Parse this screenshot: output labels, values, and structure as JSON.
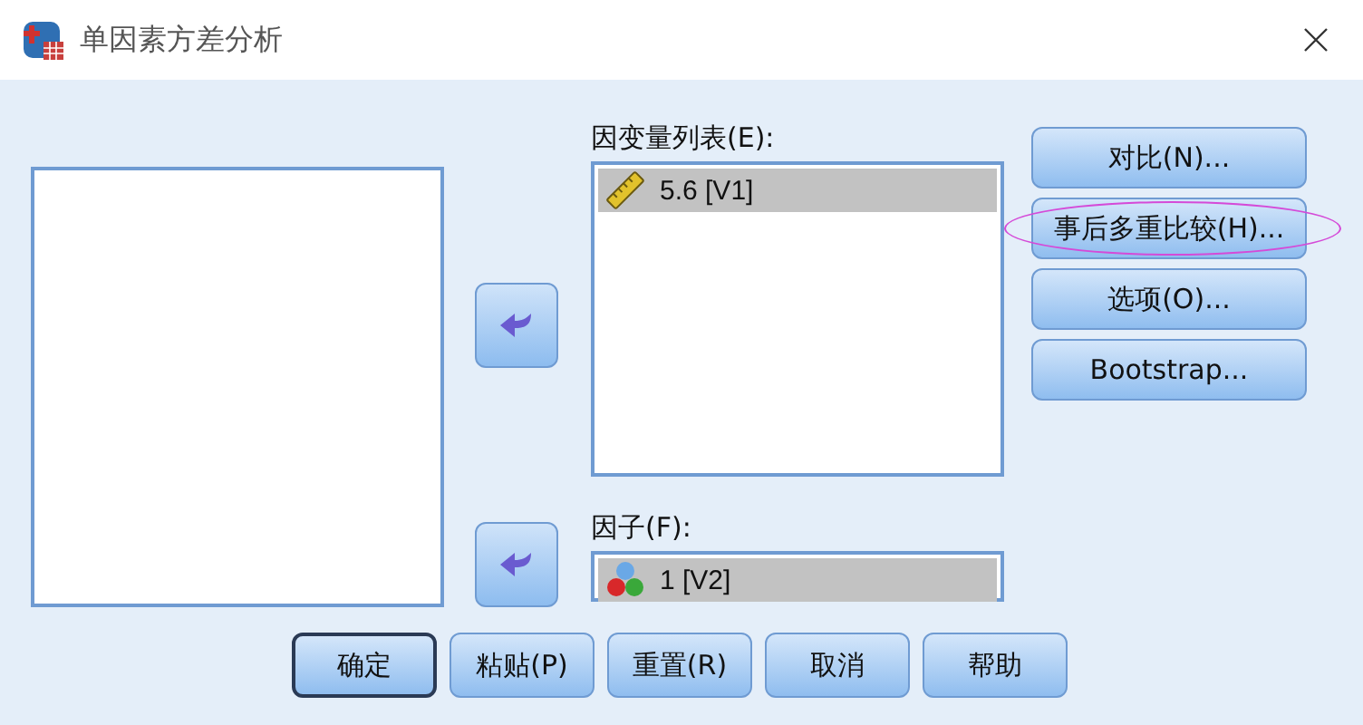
{
  "window": {
    "title": "单因素方差分析"
  },
  "dependent_list": {
    "label": "因变量列表(E):",
    "items": [
      {
        "name": "5.6 [V1]",
        "kind": "scale",
        "selected": true
      }
    ]
  },
  "factor": {
    "label": "因子(F):",
    "item": {
      "name": "1 [V2]",
      "kind": "nominal",
      "selected": true
    }
  },
  "side_buttons": [
    {
      "label": "对比(N)...",
      "circled": false
    },
    {
      "label": "事后多重比较(H)...",
      "circled": true
    },
    {
      "label": "选项(O)...",
      "circled": false
    },
    {
      "label": "Bootstrap...",
      "circled": false
    }
  ],
  "bottom_buttons": [
    {
      "label": "确定",
      "default": true
    },
    {
      "label": "粘贴(P)",
      "default": false
    },
    {
      "label": "重置(R)",
      "default": false
    },
    {
      "label": "取消",
      "default": false
    },
    {
      "label": "帮助",
      "default": false
    }
  ]
}
